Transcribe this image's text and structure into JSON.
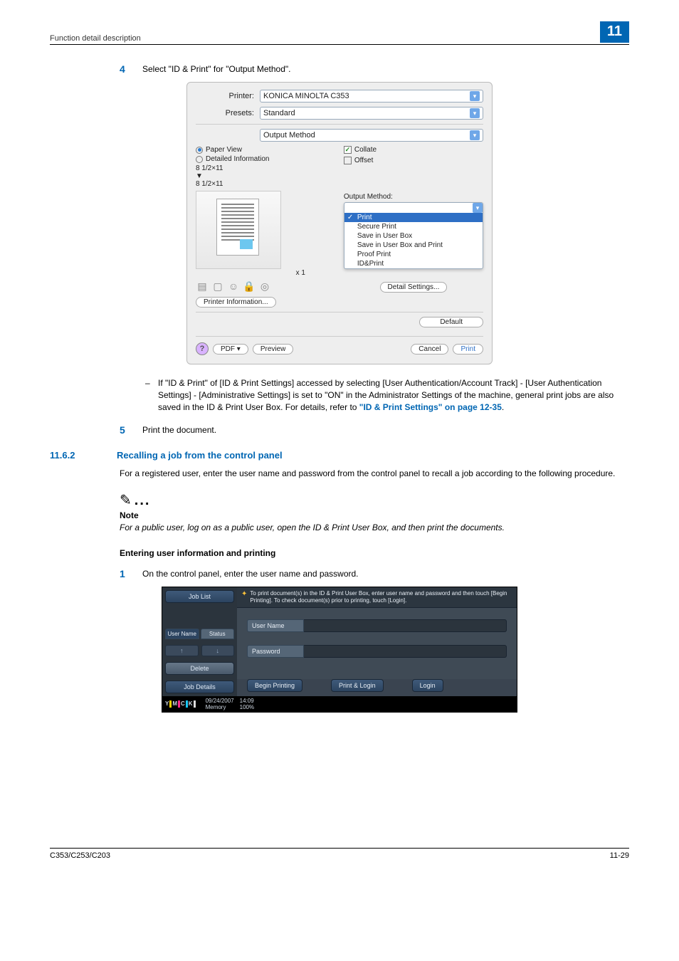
{
  "header": {
    "section_title": "Function detail description",
    "chapter": "11"
  },
  "steps": {
    "s4": {
      "num": "4",
      "text": "Select \"ID & Print\" for \"Output Method\"."
    },
    "s5": {
      "num": "5",
      "text": "Print the document."
    },
    "s1b": {
      "num": "1",
      "text": "On the control panel, enter the user name and password."
    }
  },
  "dialog": {
    "printer_label": "Printer:",
    "printer_value": "KONICA MINOLTA C353",
    "presets_label": "Presets:",
    "presets_value": "Standard",
    "tab_value": "Output Method",
    "radio_paper": "Paper View",
    "radio_detail": "Detailed Information",
    "size_a": "8 1/2×11",
    "size_arrow": "▼",
    "size_b": "8 1/2×11",
    "x1": "x 1",
    "printer_info_btn": "Printer Information...",
    "collate": "Collate",
    "offset": "Offset",
    "output_method_label": "Output Method:",
    "dd": {
      "print": "Print",
      "secure": "Secure Print",
      "save_box": "Save in User Box",
      "save_box_print": "Save in User Box and Print",
      "proof": "Proof Print",
      "idprint": "ID&Print"
    },
    "detail_btn": "Detail Settings...",
    "default_btn": "Default",
    "help": "?",
    "pdf_btn": "PDF ▾",
    "preview_btn": "Preview",
    "cancel_btn": "Cancel",
    "print_btn": "Print"
  },
  "bullet": {
    "dash": "–",
    "text_a": "If \"ID & Print\" of [ID & Print Settings] accessed by selecting [User Authentication/Account Track] - [User Authentication Settings] - [Administrative Settings] is set to \"ON\" in the Administrator Settings of the machine, general print jobs are also saved in the ID & Print User Box. For details, refer to ",
    "link": "\"ID & Print Settings\" on page 12-35",
    "period": "."
  },
  "section": {
    "num": "11.6.2",
    "title": "Recalling a job from the control panel",
    "para": "For a registered user, enter the user name and password from the control panel to recall a job according to the following procedure."
  },
  "note": {
    "icon": "✎",
    "dots": "...",
    "head": "Note",
    "text": "For a public user, log on as a public user, open the ID & Print User Box, and then print the documents."
  },
  "subhead": "Entering user information and printing",
  "panel": {
    "job_list": "Job List",
    "tab_user": "User Name",
    "tab_status": "Status",
    "up": "↑",
    "down": "↓",
    "delete": "Delete",
    "job_details": "Job Details",
    "hint": "To print document(s) in the ID & Print User Box, enter user name and password and then touch [Begin Printing]. To check document(s) prior to printing, touch [Login].",
    "user_name_label": "User Name",
    "password_label": "Password",
    "begin_printing": "Begin Printing",
    "print_login": "Print & Login",
    "login": "Login",
    "toners": {
      "y": "Y",
      "m": "M",
      "c": "C",
      "k": "K"
    },
    "date": "09/24/2007",
    "time": "14:09",
    "memory_label": "Memory",
    "memory_value": "100%"
  },
  "footer": {
    "model": "C353/C253/C203",
    "page": "11-29"
  }
}
